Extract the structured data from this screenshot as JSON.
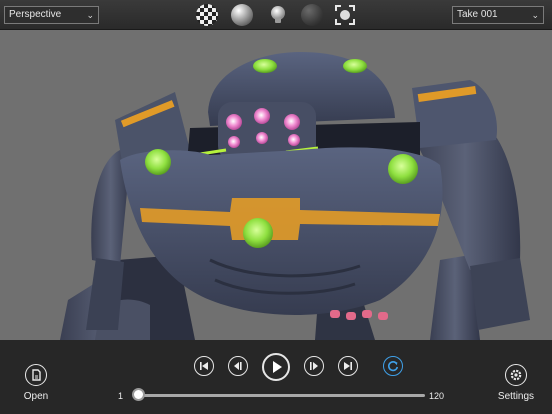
{
  "toolbar": {
    "view_select": "Perspective",
    "take_select": "Take 001",
    "tools": [
      "checkerboard-icon",
      "material-sphere-icon",
      "light-bulb-icon",
      "dark-sphere-icon",
      "focus-frame-icon"
    ]
  },
  "scene": {
    "subject": "3D robot model",
    "accent_colors": [
      "#9be84a",
      "#f0a020",
      "#e65ab4"
    ]
  },
  "controls": {
    "open_label": "Open",
    "settings_label": "Settings",
    "buttons": [
      "skip-start-icon",
      "step-back-icon",
      "play-icon",
      "step-forward-icon",
      "skip-end-icon",
      "loop-icon"
    ],
    "loop_color": "#3fa0e8"
  },
  "timeline": {
    "start_frame": "1",
    "end_frame": "120",
    "current_frame": 1
  }
}
